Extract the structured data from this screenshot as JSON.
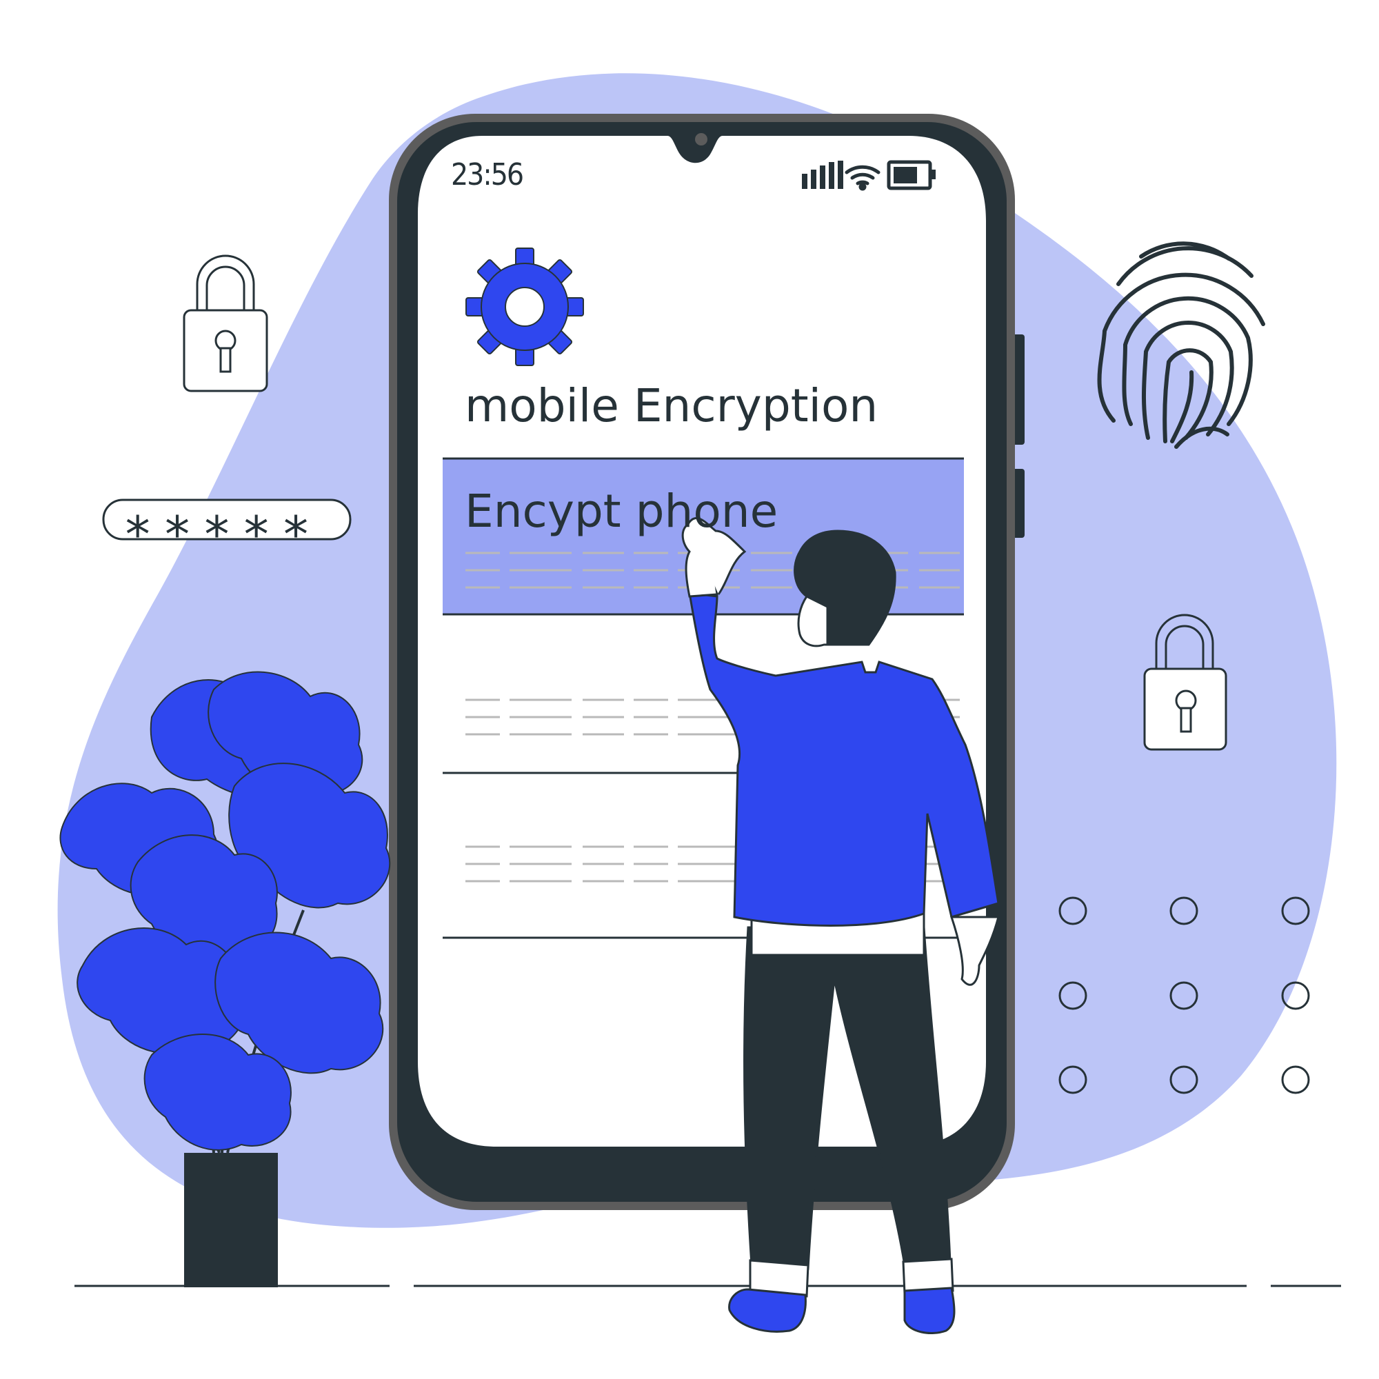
{
  "status_bar": {
    "time": "23:56",
    "icons": [
      "signal-icon",
      "wifi-icon",
      "battery-icon"
    ]
  },
  "app": {
    "icon": "gear-icon",
    "title": "mobile Encryption"
  },
  "menu": {
    "items": [
      {
        "label": "Encypt phone",
        "selected": true
      },
      {
        "label": "",
        "selected": false
      },
      {
        "label": "",
        "selected": false
      }
    ]
  },
  "decorations": {
    "password_mask": "*****",
    "icons": [
      "padlock-icon",
      "padlock-icon",
      "fingerprint-icon",
      "pattern-lock-dots-icon",
      "monstera-plant",
      "person-figure"
    ]
  },
  "colors": {
    "accent": "#2f47ef",
    "blob": "#bcc5f7",
    "highlight": "#97a3f3",
    "dark": "#263238",
    "frame": "#5c5c5c"
  }
}
